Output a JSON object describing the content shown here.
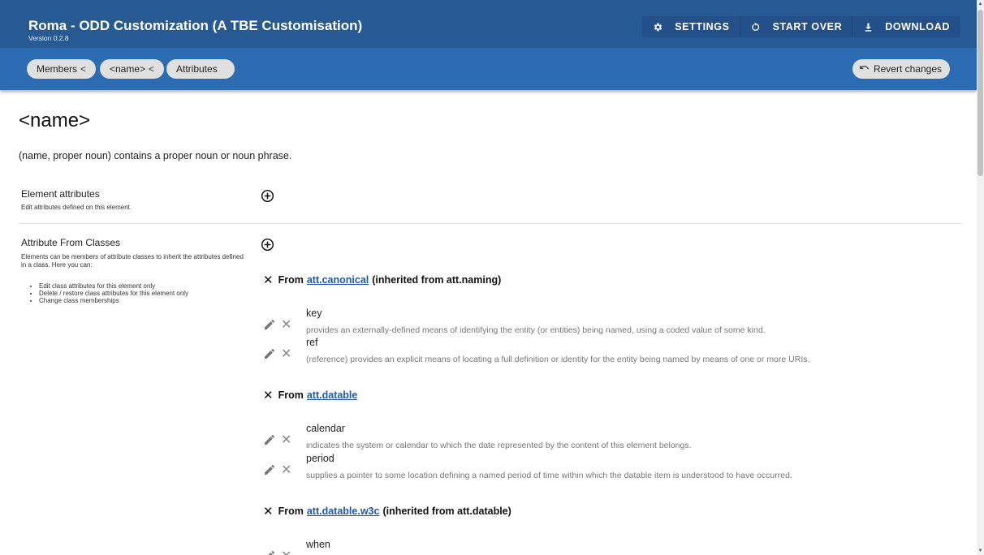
{
  "app": {
    "title": "Roma - ODD Customization (A TBE Customisation)",
    "version": "Version 0.2.8"
  },
  "toolbar": {
    "settings_label": "SETTINGS",
    "start_over_label": "START OVER",
    "download_label": "DOWNLOAD",
    "settings_icon": "gear-icon",
    "start_over_icon": "refresh-icon",
    "download_icon": "download-icon"
  },
  "breadcrumb": {
    "members": "Members",
    "name": "<name>",
    "attributes": "Attributes",
    "chevron": "<"
  },
  "revert": {
    "label": "Revert changes",
    "icon": "undo-icon"
  },
  "page": {
    "heading": "<name>",
    "description": "(name, proper noun) contains a proper noun or noun phrase."
  },
  "element_attributes": {
    "title": "Element attributes",
    "subtitle": "Edit attributes defined on this element."
  },
  "attribute_classes": {
    "title": "Attribute From Classes",
    "subtitle": "Elements can be members of attribute classes to inherit the attributes defined in a class. Here you can:",
    "bullets": [
      "Edit class attributes for this element only",
      "Delete / restore class attributes for this element only",
      "Change class memberships"
    ]
  },
  "groups": [
    {
      "prefix": "From",
      "link": "att.canonical",
      "suffix": "(inherited from att.naming)",
      "attributes": [
        {
          "name": "key",
          "desc": "provides an externally-defined means of identifying the entity (or entities) being named, using a coded value of some kind."
        },
        {
          "name": "ref",
          "desc": "(reference) provides an explicit means of locating a full definition or identity for the entity being named by means of one or more URIs."
        }
      ]
    },
    {
      "prefix": "From",
      "link": "att.datable",
      "suffix": "",
      "attributes": [
        {
          "name": "calendar",
          "desc": "indicates the system or calendar to which the date represented by the content of this element belongs."
        },
        {
          "name": "period",
          "desc": "supplies a pointer to some location defining a named period of time within which the datable item is understood to have occurred."
        }
      ]
    },
    {
      "prefix": "From",
      "link": "att.datable.w3c",
      "suffix": "(inherited from att.datable)",
      "attributes": [
        {
          "name": "when",
          "desc": ""
        }
      ]
    }
  ],
  "colors": {
    "appbar_top": "#275a92",
    "appbar_bottom": "#2a6bb1",
    "link": "#1f5aa6",
    "chip": "#e0e0e0"
  }
}
